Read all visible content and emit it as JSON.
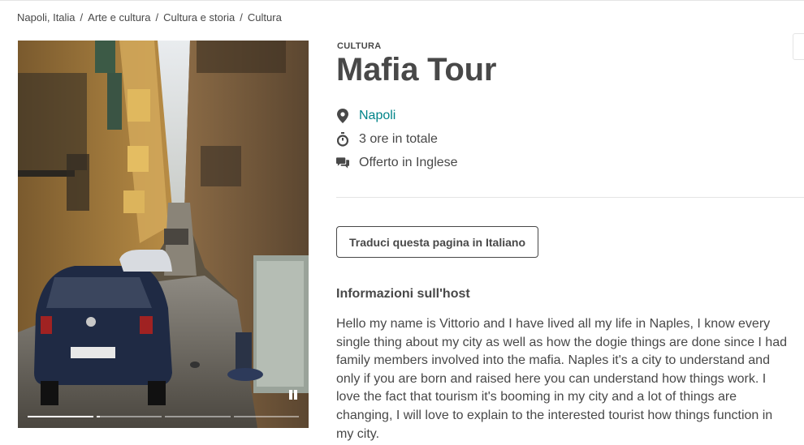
{
  "breadcrumb": {
    "items": [
      "Napoli, Italia",
      "Arte e cultura",
      "Cultura e storia",
      "Cultura"
    ],
    "separator": "/"
  },
  "media": {
    "type": "video",
    "pause_icon": "pause-icon",
    "progress_segments": [
      1,
      0.05,
      0,
      0
    ]
  },
  "experience": {
    "category": "CULTURA",
    "title": "Mafia Tour",
    "location": "Napoli",
    "duration": "3 ore in totale",
    "language": "Offerto in Inglese"
  },
  "translate": {
    "label": "Traduci questa pagina in Italiano"
  },
  "host": {
    "heading": "Informazioni sull'host",
    "description": "Hello my name is Vittorio and I have lived all my life in Naples, I know every single thing about my city as well as how the dogie things are done since I had family members involved into the mafia. Naples it's a city to understand and only if you are born and raised here you can understand how things work. I love the fact that tourism it's booming in my city and a lot of things are changing, I will love to explain to the interested tourist how things function in my city."
  },
  "colors": {
    "text": "#484848",
    "link": "#008489",
    "divider": "#e4e4e4"
  }
}
